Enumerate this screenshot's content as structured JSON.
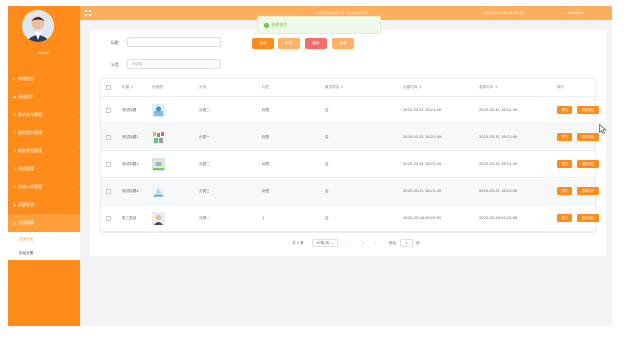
{
  "sidebar": {
    "username": "admin",
    "items": [
      {
        "label": "系统首页",
        "icon": "home-icon",
        "glyph": "⌂",
        "chevron": false
      },
      {
        "label": "系统用户",
        "icon": "user-icon",
        "glyph": "♟",
        "chevron": true
      },
      {
        "label": "需求发布管理",
        "icon": "doc-icon",
        "glyph": "☐",
        "chevron": true
      },
      {
        "label": "服务提供管理",
        "icon": "doc-icon",
        "glyph": "☐",
        "chevron": true
      },
      {
        "label": "服务类型管理",
        "icon": "doc-icon",
        "glyph": "☐",
        "chevron": true
      },
      {
        "label": "系统管理",
        "icon": "settings-icon",
        "glyph": "☑",
        "chevron": true
      },
      {
        "label": "系统公告管理",
        "icon": "notice-icon",
        "glyph": "⊙",
        "chevron": true
      },
      {
        "label": "资源管理",
        "icon": "resource-icon",
        "glyph": "◈",
        "chevron": true
      },
      {
        "label": "交流管理",
        "icon": "chat-icon",
        "glyph": "◎",
        "chevron": true
      }
    ],
    "submenu": [
      "交流论坛",
      "论坛分类"
    ]
  },
  "topbar": {
    "faint_text": "社区服务管理平台 后台管理系统",
    "date": "2025-03-26 09:29:23",
    "user": "admin ▾"
  },
  "toast": {
    "message": "修改成功"
  },
  "filters": {
    "title_label": "标题",
    "title_value": "",
    "category_label": "分类",
    "category_placeholder": "请选择",
    "category_arrow": "⌄"
  },
  "buttons": {
    "search": "查询",
    "add": "新增",
    "delete": "删除",
    "report": "报表"
  },
  "colors": {
    "accent": "#ff8c1a",
    "search": "#ff8c1a",
    "add": "#ffb266",
    "delete": "#f56c6c",
    "report": "#ffb266"
  },
  "table": {
    "columns": [
      "标题 ↕",
      "封面图",
      "分类",
      "标签",
      "置顶状态 ↕",
      "创建时间 ↕",
      "更新时间 ↕",
      "操作"
    ],
    "rows": [
      {
        "title": "测试标题",
        "category": "分类二",
        "tags": "标签",
        "top": "否",
        "created": "2025-03-31 18:21:49",
        "updated": "2025-03-31 18:21:49",
        "thumb": "pic1"
      },
      {
        "title": "测试标题2",
        "category": "分类一",
        "tags": "标签",
        "top": "否",
        "created": "2025-03-31 18:21:49",
        "updated": "2025-03-31 18:21:49",
        "thumb": "pic2"
      },
      {
        "title": "测试标题3",
        "category": "分类二",
        "tags": "标签",
        "top": "否",
        "created": "2025-03-31 18:21:49",
        "updated": "2025-03-31 18:21:49",
        "thumb": "pic3"
      },
      {
        "title": "测试标题4",
        "category": "分类三",
        "tags": "标签",
        "top": "否",
        "created": "2025-03-31 18:21:49",
        "updated": "2025-03-31 18:21:49",
        "thumb": "pic4"
      },
      {
        "title": "张三发帖",
        "category": "分类一",
        "tags": "1",
        "top": "否",
        "created": "2025-03-26 09:23:55",
        "updated": "2025-03-26 09:23:58",
        "thumb": "pic5"
      }
    ],
    "action_detail": "详情",
    "action_review": "查看评论"
  },
  "pager": {
    "total": "共 5 条",
    "size": "10条/页",
    "size_arrow": "⌄",
    "prev": "‹",
    "page": "1",
    "next": "›",
    "goto_prefix": "前往",
    "goto_value": "1",
    "goto_suffix": "页"
  }
}
